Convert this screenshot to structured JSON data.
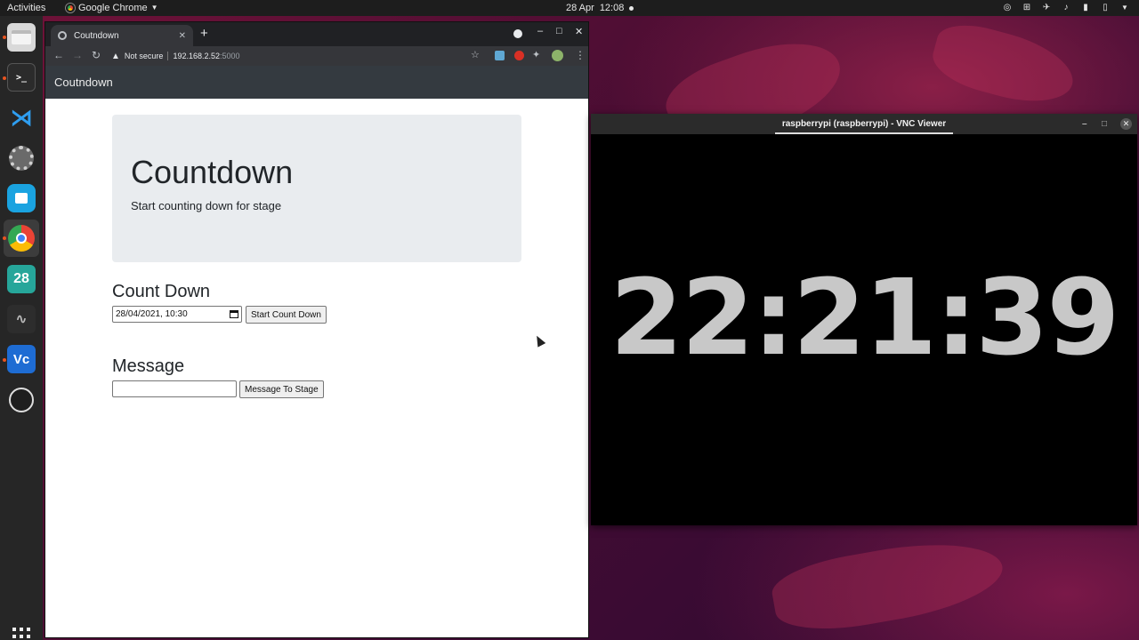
{
  "topbar": {
    "activities": "Activities",
    "app_menu": "Google Chrome",
    "date": "28 Apr",
    "time": "12:08"
  },
  "dock": {
    "items": [
      "files",
      "terminal",
      "vscode",
      "settings",
      "software",
      "chrome",
      "calendar",
      "system-monitor",
      "vnc-viewer",
      "obs"
    ],
    "calendar_day": "28",
    "vnc_label": "Vc"
  },
  "browser": {
    "tab_title": "Coutndown",
    "security_label": "Not secure",
    "url_host": "192.168.2.52",
    "url_port": ":5000"
  },
  "page": {
    "navbar_brand": "Coutndown",
    "jumbotron": {
      "title": "Countdown",
      "subtitle": "Start counting down for stage"
    },
    "countdown_section": {
      "heading": "Count Down",
      "datetime_value": "28/04/2021, 10:30",
      "button_label": "Start Count Down"
    },
    "message_section": {
      "heading": "Message",
      "input_value": "",
      "button_label": "Message To Stage"
    }
  },
  "vnc": {
    "window_title": "raspberrypi (raspberrypi) - VNC Viewer",
    "timer": "22:21:39"
  },
  "colors": {
    "navbar": "#343a40",
    "jumbotron": "#e9ecef",
    "ubuntu_orange": "#e95420"
  }
}
